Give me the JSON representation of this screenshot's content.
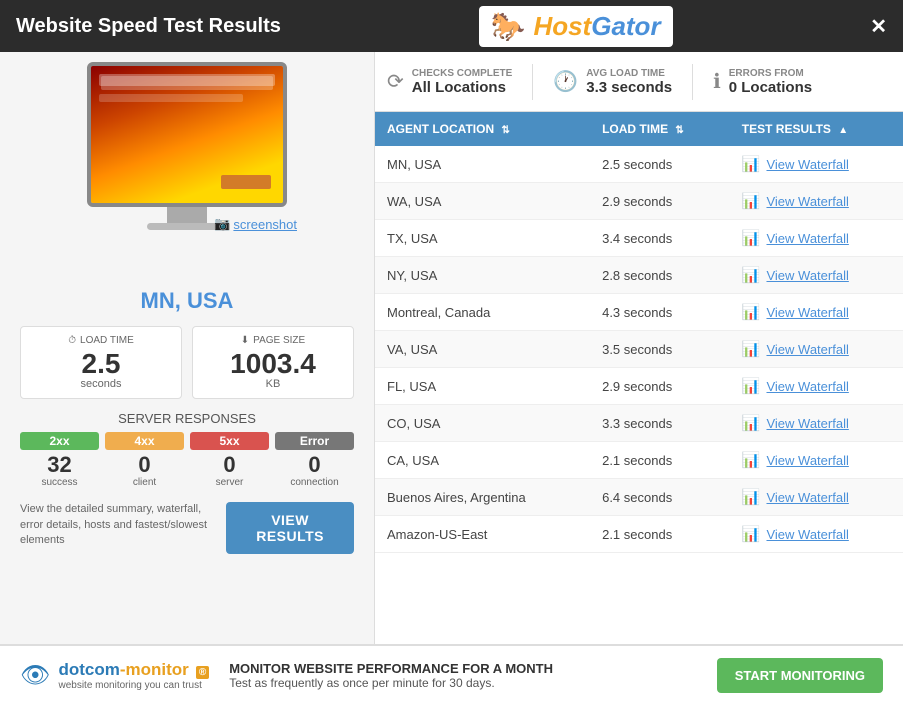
{
  "titleBar": {
    "title": "Website Speed Test Results",
    "closeLabel": "✕"
  },
  "logo": {
    "seahorse": "🐴",
    "text": "HostGator"
  },
  "leftPanel": {
    "location": "MN, USA",
    "screenshot": "screenshot",
    "loadTime": {
      "label": "LOAD TIME",
      "value": "2.5",
      "unit": "seconds"
    },
    "pageSize": {
      "label": "PAGE SIZE",
      "value": "1003.4",
      "unit": "KB"
    },
    "serverResponsesTitle": "SERVER RESPONSES",
    "responses": [
      {
        "badge": "2xx",
        "count": "32",
        "type": "success"
      },
      {
        "badge": "4xx",
        "count": "0",
        "type": "client"
      },
      {
        "badge": "5xx",
        "count": "0",
        "type": "server"
      },
      {
        "badge": "Error",
        "count": "0",
        "type": "connection"
      }
    ],
    "summaryText": "View the detailed summary, waterfall, error details, hosts and fastest/slowest elements",
    "viewResultsBtn": "VIEW RESULTS"
  },
  "summaryHeader": {
    "checks": {
      "label": "CHECKS COMPLETE",
      "value": "All Locations"
    },
    "avgLoad": {
      "label": "AVG LOAD TIME",
      "value": "3.3 seconds"
    },
    "errors": {
      "label": "ERRORS FROM",
      "value": "0 Locations"
    }
  },
  "table": {
    "headers": [
      {
        "label": "AGENT LOCATION",
        "sort": "⇅"
      },
      {
        "label": "LOAD TIME",
        "sort": "⇅"
      },
      {
        "label": "TEST RESULTS",
        "sort": "▲"
      }
    ],
    "rows": [
      {
        "location": "MN, USA",
        "loadTime": "2.5 seconds",
        "waterfall": "View Waterfall"
      },
      {
        "location": "WA, USA",
        "loadTime": "2.9 seconds",
        "waterfall": "View Waterfall"
      },
      {
        "location": "TX, USA",
        "loadTime": "3.4 seconds",
        "waterfall": "View Waterfall"
      },
      {
        "location": "NY, USA",
        "loadTime": "2.8 seconds",
        "waterfall": "View Waterfall"
      },
      {
        "location": "Montreal, Canada",
        "loadTime": "4.3 seconds",
        "waterfall": "View Waterfall"
      },
      {
        "location": "VA, USA",
        "loadTime": "3.5 seconds",
        "waterfall": "View Waterfall"
      },
      {
        "location": "FL, USA",
        "loadTime": "2.9 seconds",
        "waterfall": "View Waterfall"
      },
      {
        "location": "CO, USA",
        "loadTime": "3.3 seconds",
        "waterfall": "View Waterfall"
      },
      {
        "location": "CA, USA",
        "loadTime": "2.1 seconds",
        "waterfall": "View Waterfall"
      },
      {
        "location": "Buenos Aires, Argentina",
        "loadTime": "6.4 seconds",
        "waterfall": "View Waterfall"
      },
      {
        "location": "Amazon-US-East",
        "loadTime": "2.1 seconds",
        "waterfall": "View Waterfall"
      }
    ]
  },
  "footer": {
    "logoIcon": "👁",
    "logoText": "dotcom-monitor",
    "logoSub": "website monitoring you can trust",
    "monitorText": "MONITOR WEBSITE PERFORMANCE FOR A MONTH",
    "monitorSub": "Test as frequently as once per minute for 30 days.",
    "startBtn": "START MONITORING"
  }
}
